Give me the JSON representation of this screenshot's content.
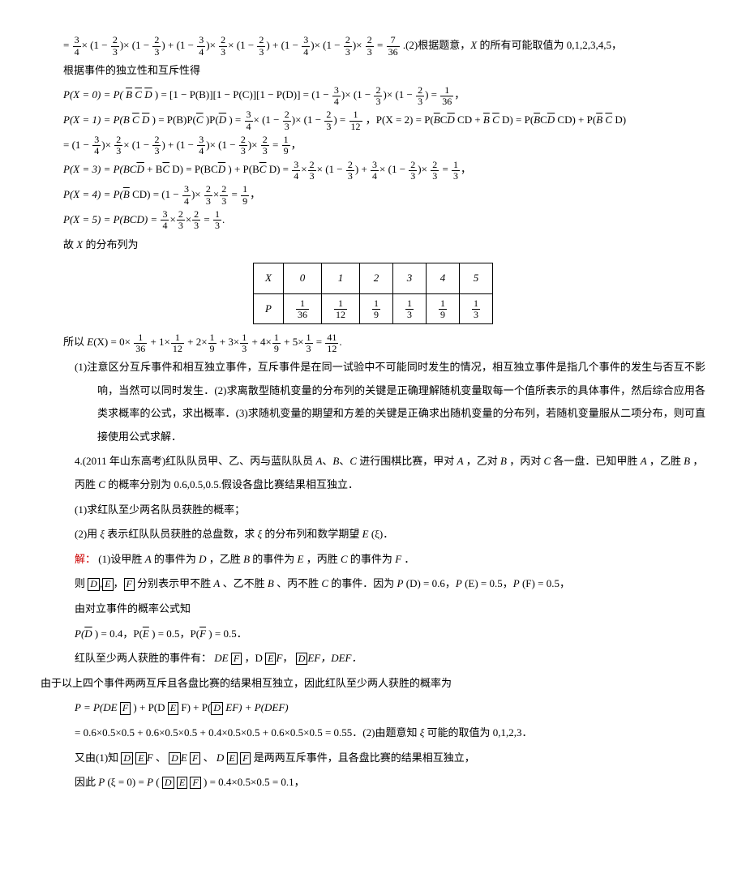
{
  "l1a": "= ",
  "l1b": ".(2)根据题意，",
  "l1c": " 的所有可能取值为 0,1,2,3,4,5，",
  "l2": "根据事件的独立性和互斥性得",
  "l3a": "P(X = 0) = P(",
  "l3b": ") = [1 − P(B)][1 − P(C)][1 − P(D)] = ",
  "l4a": "P(X = 1) = P(B ",
  "l4b": ") = P(B)P(",
  "l4c": ")P(",
  "l4d": ") = ",
  "l4e": "，P(X = 2) = P(",
  "l4f": "CD + ",
  "l4g": "D) = P(",
  "l4h": "CD) + P(",
  "l4i": "D)",
  "l5": "= ",
  "l6a": "P(X = 3) = P(BC",
  "l6b": " + B",
  "l6c": "D) = P(BC",
  "l6d": ") + P(B",
  "l6e": "D) = ",
  "l7a": "P(X = 4) = P(",
  "l7b": "CD) = ",
  "l8": "P(X = 5) = P(BCD) = ",
  "l9a": "故 ",
  "l9b": " 的分布列为",
  "thX": "X",
  "thP": "P",
  "c0": "0",
  "c1": "1",
  "c2": "2",
  "c3": "3",
  "c4": "4",
  "c5": "5",
  "l10a": "所以 ",
  "l10b": "(X) = 0×",
  "l10c": " + 1×",
  "l10d": " + 2×",
  "l10e": " + 3×",
  "l10f": " + 4×",
  "l10g": " + 5×",
  "l10h": " = ",
  "p1": "(1)注意区分互斥事件和相互独立事件，互斥事件是在同一试验中不可能同时发生的情况，相互独立事件是指几个事件的发生与否互不影响，当然可以同时发生．(2)求离散型随机变量的分布列的关键是正确理解随机变量取每一个值所表示的具体事件，然后综合应用各类求概率的公式，求出概率．(3)求随机变量的期望和方差的关键是正确求出随机变量的分布列，若随机变量服从二项分布，则可直接使用公式求解．",
  "q4a": "4.(2011 年山东高考)红队队员甲、乙、丙与蓝队队员 ",
  "q4b": "、",
  "q4c": " 进行围棋比赛，甲对 ",
  "q4d": "，乙对 ",
  "q4e": "，丙对 ",
  "q4f": " 各一盘．已知甲胜 ",
  "q4g": "，乙胜 ",
  "q4h": "，丙胜 ",
  "q4i": " 的概率分别为 0.6,0.5,0.5.假设各盘比赛结果相互独立．",
  "q4p1": "(1)求红队至少两名队员获胜的概率；",
  "q4p2a": "(2)用 ",
  "q4p2b": " 表示红队队员获胜的总盘数，求 ",
  "q4p2c": " 的分布列和数学期望 ",
  "q4p2d": "(ξ)．",
  "sol": "解：",
  "s1a": "(1)设甲胜 ",
  "s1b": " 的事件为 ",
  "s1c": "，乙胜 ",
  "s1d": " 的事件为 ",
  "s1e": "，丙胜 ",
  "s1f": " 的事件为 ",
  "s1g": "．",
  "s2a": "则",
  "s2b": "分别表示甲不胜 ",
  "s2c": "、乙不胜 ",
  "s2d": "、丙不胜 ",
  "s2e": " 的事件．因为 ",
  "s2f": "(D) = 0.6，",
  "s2g": "(E) = 0.5，",
  "s2h": "(F) = 0.5，",
  "s3": "由对立事件的概率公式知",
  "s4a": "P(",
  "s4b": ") = 0.4，P(",
  "s4c": ") = 0.5，P(",
  "s4d": ") = 0.5．",
  "s5a": "红队至少两人获胜的事件有：",
  "s5b": "DE ",
  "s5c": "，D ",
  "s5d": "F，",
  "s5e": "EF，DEF．",
  "s6": "由于以上四个事件两两互斥且各盘比赛的结果相互独立，因此红队至少两人获胜的概率为",
  "s7a": "P = P(DE ",
  "s7b": ") + P(D ",
  "s7c": "F) + P(",
  "s7d": "EF) + P(DEF)",
  "s8a": "= 0.6×0.5×0.5 + 0.6×0.5×0.5 + 0.4×0.5×0.5 + 0.6×0.5×0.5 = 0.55．(2)由题意知 ",
  "s8b": " 可能的取值为 0,1,2,3．",
  "s9a": "又由(1)知",
  "s9b": "、",
  "s9c": "、",
  "s9d": "是两两互斥事件，且各盘比赛的结果相互独立，",
  "s10a": "因此 ",
  "s10b": "(ξ = 0) = ",
  "s10c": "(",
  "s10d": ") = 0.4×0.5×0.5 = 0.1，",
  "chart_data": {
    "type": "table",
    "title": "X 的分布列",
    "columns": [
      "X",
      "0",
      "1",
      "2",
      "3",
      "4",
      "5"
    ],
    "rows": [
      {
        "label": "P",
        "values": [
          "1/36",
          "1/12",
          "1/9",
          "1/3",
          "1/9",
          "1/3"
        ]
      }
    ],
    "expectation": "E(X) = 41/12"
  }
}
